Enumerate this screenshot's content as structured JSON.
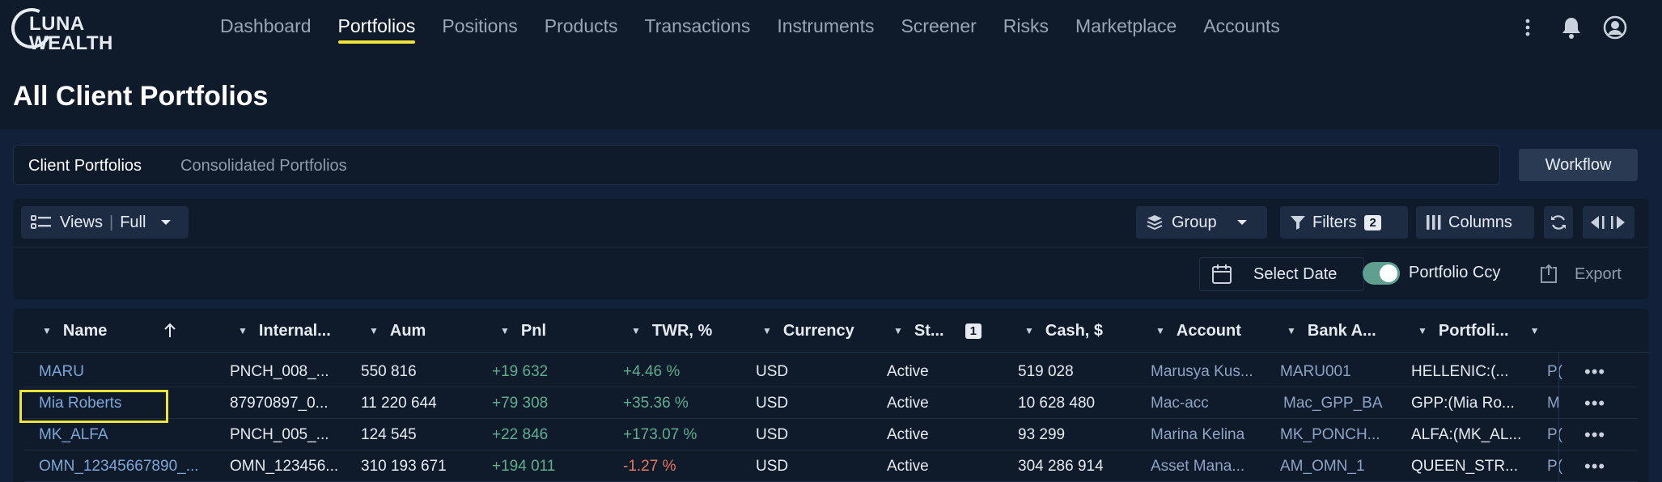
{
  "logo": {
    "line1": "LUNA",
    "line2": "WEALTH"
  },
  "nav": [
    "Dashboard",
    "Portfolios",
    "Positions",
    "Products",
    "Transactions",
    "Instruments",
    "Screener",
    "Risks",
    "Marketplace",
    "Accounts"
  ],
  "nav_active": "Portfolios",
  "page_title": "All Client Portfolios",
  "tabs": {
    "client": "Client Portfolios",
    "consolidated": "Consolidated Portfolios"
  },
  "workflow_label": "Workflow",
  "toolbar": {
    "views_label": "Views",
    "views_value": "Full",
    "group_label": "Group",
    "filters_label": "Filters",
    "filters_count": "2",
    "columns_label": "Columns",
    "select_date": "Select Date",
    "portfolio_ccy": "Portfolio Ccy",
    "export": "Export"
  },
  "columns": {
    "name": "Name",
    "internal": "Internal...",
    "aum": "Aum",
    "pnl": "Pnl",
    "twr": "TWR, %",
    "currency": "Currency",
    "status": "St...",
    "status_badge": "1",
    "cash": "Cash, $",
    "account": "Account",
    "bank": "Bank A...",
    "portfolio": "Portfoli..."
  },
  "rows": [
    {
      "name": "MARU",
      "internal": "PNCH_008_...",
      "aum": "550 816",
      "pnl": "+19 632",
      "twr": "+4.46 %",
      "currency": "USD",
      "status": "Active",
      "cash": "519 028",
      "account": "Marusya Kus...",
      "bank": "MARU001",
      "portfolio": "HELLENIC:(...",
      "extra": "P("
    },
    {
      "name": "Mia Roberts",
      "internal": "87970897_0...",
      "aum": "11 220 644",
      "pnl": "+79 308",
      "twr": "+35.36 %",
      "currency": "USD",
      "status": "Active",
      "cash": "10 628 480",
      "account": "Mac-acc",
      "bank": "Mac_GPP_BA",
      "portfolio": "GPP:(Mia Ro...",
      "extra": "M"
    },
    {
      "name": "MK_ALFA",
      "internal": "PNCH_005_...",
      "aum": "124 545",
      "pnl": "+22 846",
      "twr": "+173.07 %",
      "currency": "USD",
      "status": "Active",
      "cash": "93 299",
      "account": "Marina Kelina",
      "bank": "MK_PONCH...",
      "portfolio": "ALFA:(MK_AL...",
      "extra": "P("
    },
    {
      "name": "OMN_12345667890_...",
      "internal": "OMN_123456...",
      "aum": "310 193 671",
      "pnl": "+194 011",
      "twr": "-1.27 %",
      "currency": "USD",
      "status": "Active",
      "cash": "304 286 914",
      "account": "Asset Mana...",
      "bank": "AM_OMN_1",
      "portfolio": "QUEEN_STR...",
      "extra": "P("
    }
  ],
  "colors": {
    "accent": "#f2e33b",
    "positive": "#5fae8e",
    "negative": "#e87a5e",
    "link": "#7ea7d6",
    "bg": "#0f1a2b"
  }
}
